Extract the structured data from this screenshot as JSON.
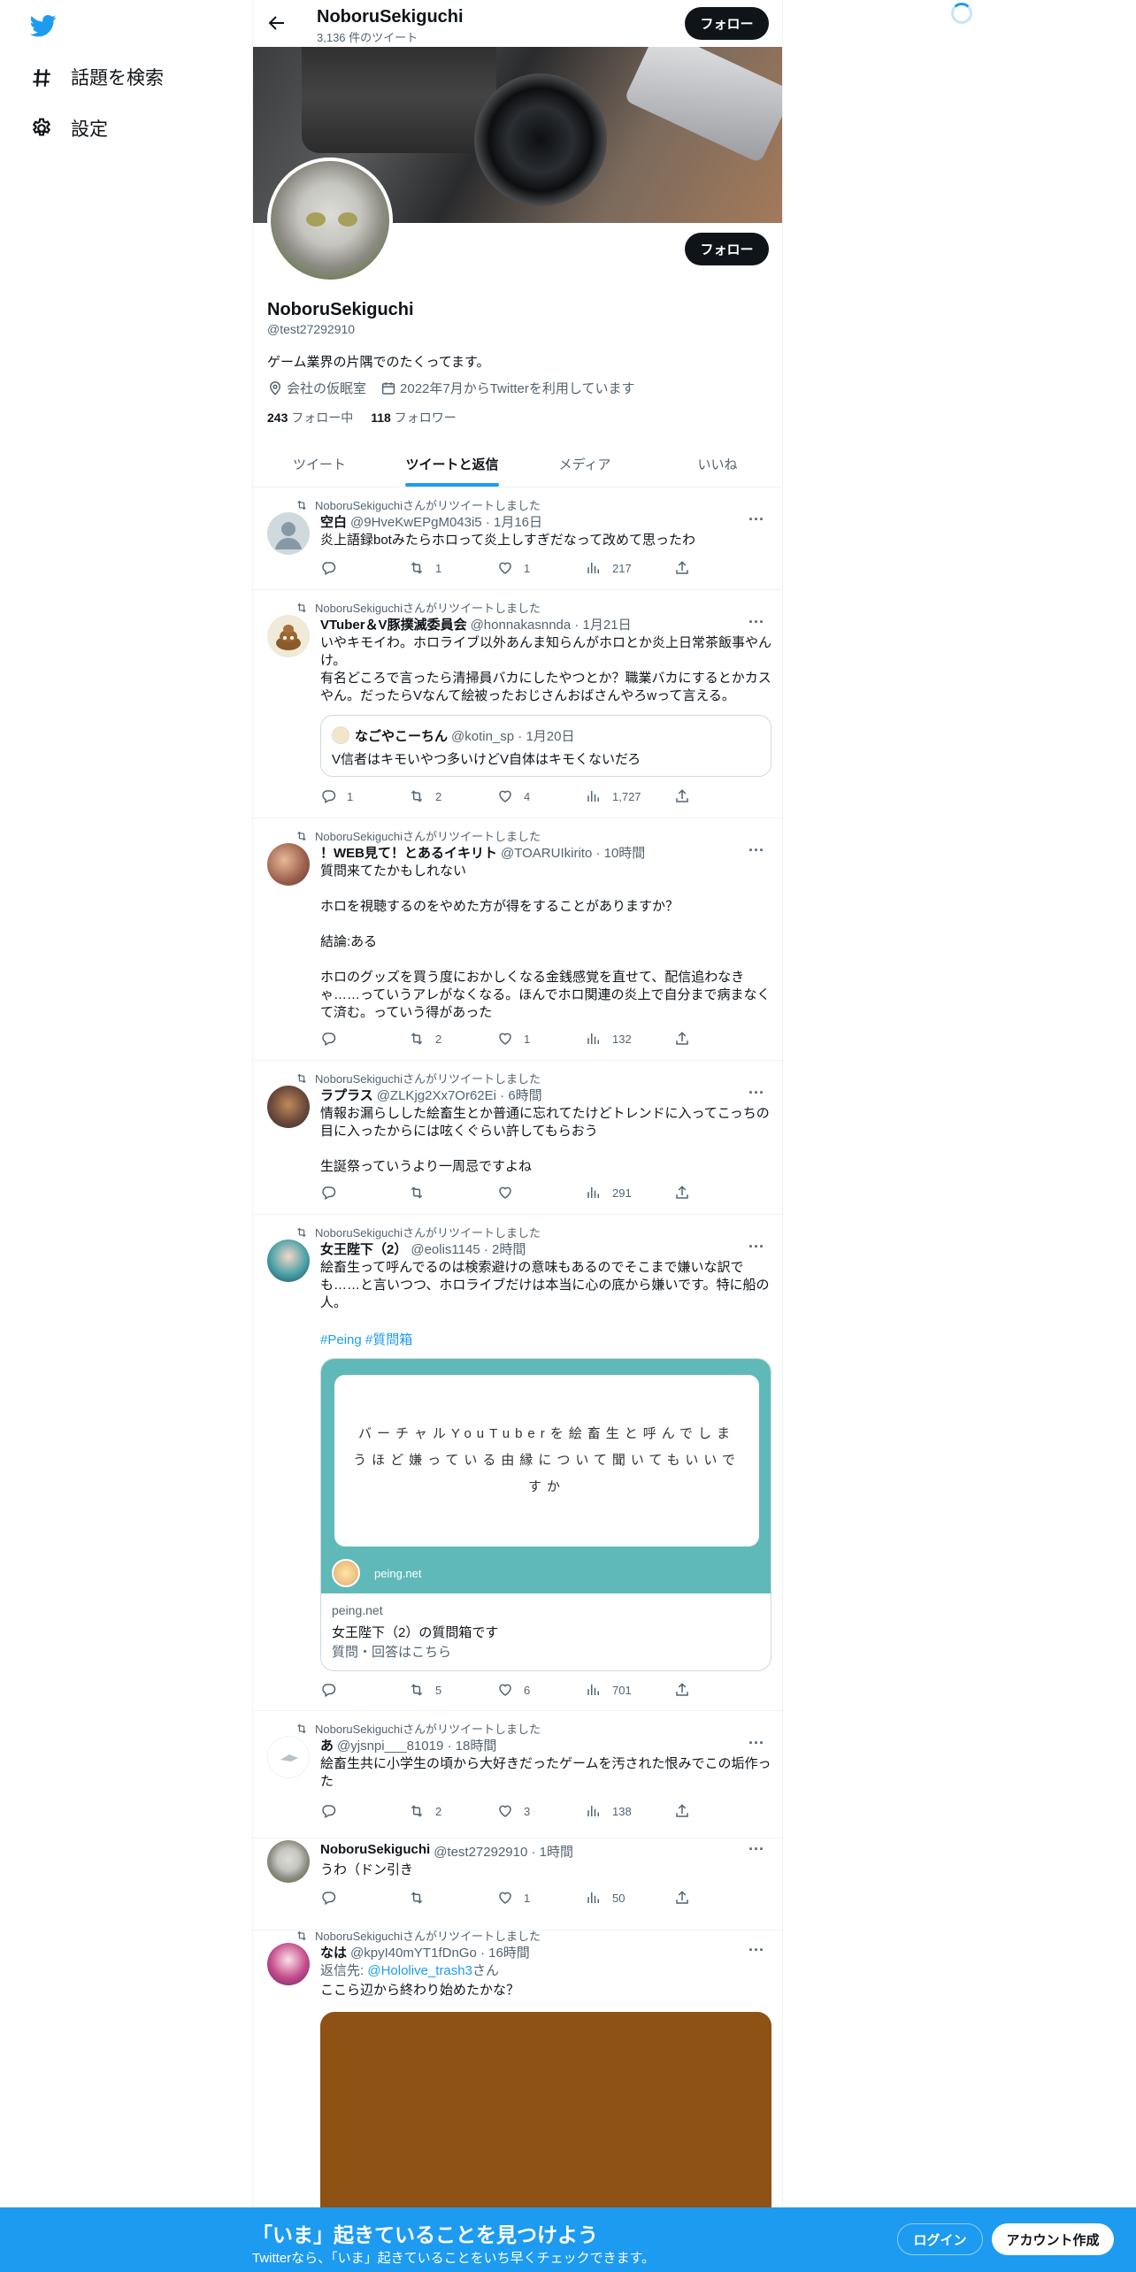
{
  "sidebar": {
    "logo": "twitter-bird-icon",
    "items": [
      {
        "label": "話題を検索",
        "icon": "hashtag-icon"
      },
      {
        "label": "設定",
        "icon": "gear-icon"
      }
    ]
  },
  "header": {
    "name": "NoboruSekiguchi",
    "tweet_count": "3,136 件のツイート",
    "follow_label": "フォロー"
  },
  "profile": {
    "follow_label": "フォロー",
    "name": "NoboruSekiguchi",
    "handle": "@test27292910",
    "bio": "ゲーム業界の片隅でのたくってます。",
    "location": "会社の仮眠室",
    "joined": "2022年7月からTwitterを利用しています",
    "following_count": "243",
    "following_label": "フォロー中",
    "followers_count": "118",
    "followers_label": "フォロワー"
  },
  "tabs": [
    {
      "label": "ツイート",
      "active": false
    },
    {
      "label": "ツイートと返信",
      "active": true
    },
    {
      "label": "メディア",
      "active": false
    },
    {
      "label": "いいね",
      "active": false
    }
  ],
  "tweets": [
    {
      "retweet_line": "NoboruSekiguchiさんがリツイートしました",
      "name": "空白",
      "handle": "@9HveKwEPgM043i5 · 1月16日",
      "text": "炎上語録botみたらホロって炎上しすぎだなって改めて思ったわ",
      "replies": "",
      "retweets": "1",
      "likes": "1",
      "views": "217"
    },
    {
      "retweet_line": "NoboruSekiguchiさんがリツイートしました",
      "name": "VTuber＆V豚撲滅委員会",
      "handle": "@honnakasnnda · 1月21日",
      "text": "いやキモイわ。ホロライブ以外あんま知らんがホロとか炎上日常茶飯事やんけ。\n有名どころで言ったら清掃員バカにしたやつとか？職業バカにするとかカスやん。だったらVなんて絵被ったおじさんおばさんやろwって言える。",
      "quote": {
        "name": "なごやこーちん",
        "handle": "@kotin_sp · 1月20日",
        "text": "V信者はキモいやつ多いけどV自体はキモくないだろ"
      },
      "replies": "1",
      "retweets": "2",
      "likes": "4",
      "views": "1,727"
    },
    {
      "retweet_line": "NoboruSekiguchiさんがリツイートしました",
      "name": "！WEB見て！とあるイキリト",
      "handle": "@TOARUIkirito · 10時間",
      "text": "質問来てたかもしれない\n\nホロを視聴するのをやめた方が得をすることがありますか？\n\n結論:ある\n\nホロのグッズを買う度におかしくなる金銭感覚を直せて、配信追わなきゃ……っていうアレがなくなる。ほんでホロ関連の炎上で自分まで病まなくて済む。っていう得があった",
      "replies": "",
      "retweets": "2",
      "likes": "1",
      "views": "132"
    },
    {
      "retweet_line": "NoboruSekiguchiさんがリツイートしました",
      "name": "ラプラス",
      "handle": "@ZLKjg2Xx7Or62Ei · 6時間",
      "text": "情報お漏らしした絵畜生とか普通に忘れてたけどトレンドに入ってこっちの目に入ったからには呟くぐらい許してもらおう\n\n生誕祭っていうより一周忌ですよね",
      "replies": "",
      "retweets": "",
      "likes": "",
      "views": "291"
    },
    {
      "retweet_line": "NoboruSekiguchiさんがリツイートしました",
      "name": "女王陛下（2）",
      "handle": "@eolis1145 · 2時間",
      "text": "絵畜生って呼んでるのは検索避けの意味もあるのでそこまで嫌いな訳でも……と言いつつ、ホロライブだけは本当に心の底から嫌いです。特に船の人。",
      "hashtags": "#Peing #質問箱",
      "card": {
        "image_text": "バーチャルYouTuberを絵畜生と呼んでしまうほど嫌っている由縁について聞いてもいいですか",
        "badge": "peing.net",
        "domain": "peing.net",
        "title": "女王陛下（2）の質問箱です",
        "desc": "質問・回答はこちら"
      },
      "replies": "",
      "retweets": "5",
      "likes": "6",
      "views": "701"
    },
    {
      "retweet_line": "NoboruSekiguchiさんがリツイートしました",
      "name": "あ",
      "handle": "@yjsnpi___81019 · 18時間",
      "text": "絵畜生共に小学生の頃から大好きだったゲームを汚された恨みでこの垢作った",
      "replies": "",
      "retweets": "2",
      "likes": "3",
      "views": "138"
    },
    {
      "name": "NoboruSekiguchi",
      "handle": "@test27292910 · 1時間",
      "text": "うわ（ドン引き",
      "replies": "",
      "retweets": "",
      "likes": "1",
      "views": "50"
    },
    {
      "retweet_line": "NoboruSekiguchiさんがリツイートしました",
      "name": "なは",
      "handle": "@kpyI40mYT1fDnGo · 16時間",
      "reply_prefix": "返信先: ",
      "reply_to": "@Hololive_trash3",
      "reply_suffix": "さん",
      "text": "ここら辺から終わり始めたかな？"
    }
  ],
  "bottom_bar": {
    "title": "「いま」起きていることを見つけよう",
    "subtitle": "Twitterなら、「いま」起きていることをいち早くチェックできます。",
    "login_label": "ログイン",
    "signup_label": "アカウント作成"
  },
  "colors": {
    "accent": "#1d9bf0",
    "text": "#0f1419",
    "muted": "#536471",
    "card_teal": "#5fb9b9",
    "media_brown": "#8e5215"
  }
}
